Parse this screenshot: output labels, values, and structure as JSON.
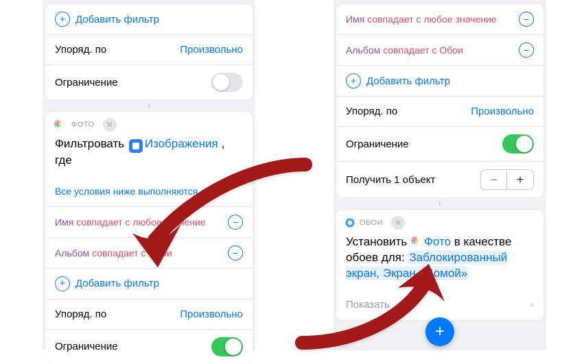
{
  "left": {
    "add_filter": "Добавить фильтр",
    "sort_label": "Упоряд. по",
    "sort_value": "Произвольно",
    "limit_label": "Ограничение",
    "card2": {
      "app": "ФОТО",
      "title_prefix": "Фильтровать",
      "title_token": "Изображения",
      "title_suffix": ", где",
      "all_cond": "Все условия ниже выполняются",
      "cond1_field": "Имя",
      "cond1_op": "совпадает с",
      "cond1_val": "любое значение",
      "cond2_field": "Альбом",
      "cond2_op": "совпадает с",
      "cond2_val": "Обои",
      "add_filter": "Добавить фильтр",
      "sort_label": "Упоряд. по",
      "sort_value": "Произвольно",
      "limit_label": "Ограничение"
    }
  },
  "right": {
    "cond1_field": "Имя",
    "cond1_op": "совпадает с",
    "cond1_val": "любое значение",
    "cond2_field": "Альбом",
    "cond2_op": "совпадает с",
    "cond2_val": "Обои",
    "add_filter": "Добавить фильтр",
    "sort_label": "Упоряд. по",
    "sort_value": "Произвольно",
    "limit_label": "Ограничение",
    "get_one": "Получить 1 объект",
    "card2": {
      "app": "ОБОИ",
      "t1": "Установить",
      "t2": "Фото",
      "t3": "в качестве обоев для:",
      "target": "Заблокированный экран, Экран «Домой»",
      "show": "Показать"
    }
  }
}
